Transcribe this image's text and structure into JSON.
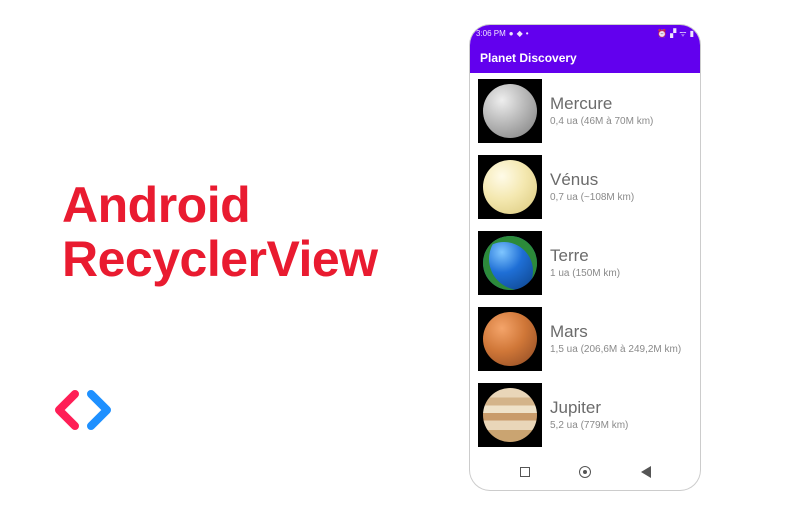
{
  "title": {
    "line1": "Android",
    "line2": "RecyclerView"
  },
  "status": {
    "time": "3:06 PM",
    "icons_left": [
      "circle",
      "diamond",
      "dot"
    ],
    "icons_right": [
      "alarm",
      "signal",
      "wifi",
      "battery"
    ]
  },
  "app": {
    "title": "Planet Discovery"
  },
  "planets": [
    {
      "name": "Mercure",
      "detail": "0,4 ua (46M à 70M km)",
      "thumb_class": "p-mercure"
    },
    {
      "name": "Vénus",
      "detail": "0,7 ua (~108M km)",
      "thumb_class": "p-venus"
    },
    {
      "name": "Terre",
      "detail": "1 ua (150M km)",
      "thumb_class": "p-terre"
    },
    {
      "name": "Mars",
      "detail": "1,5 ua (206,6M à 249,2M km)",
      "thumb_class": "p-mars"
    },
    {
      "name": "Jupiter",
      "detail": "5,2 ua (779M km)",
      "thumb_class": "p-jupiter"
    }
  ],
  "nav": {
    "items": [
      "recent",
      "home",
      "back"
    ]
  }
}
